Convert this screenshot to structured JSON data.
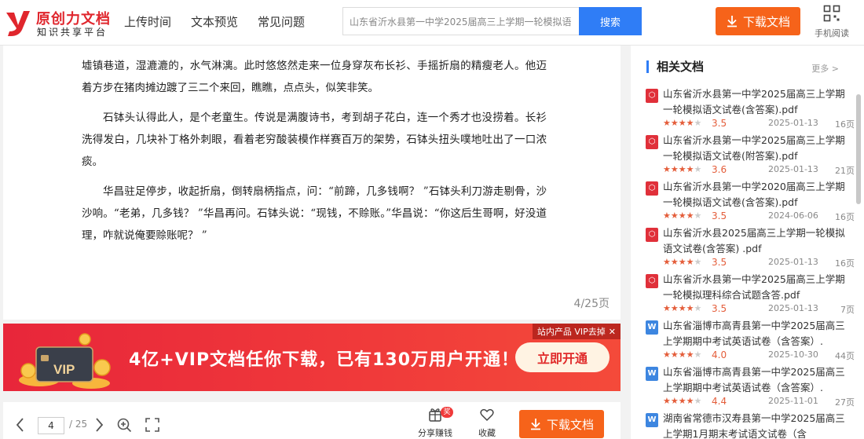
{
  "header": {
    "logo_name": "原创力文档",
    "logo_sub": "知识共享平台",
    "nav": [
      "上传时间",
      "文本预览",
      "常见问题"
    ],
    "search_value": "山东省沂水县第一中学2025届高三上学期一轮模拟语",
    "search_button": "搜索",
    "download_label": "下载文档",
    "mobile_label": "手机阅读"
  },
  "document": {
    "paragraphs": [
      "墟镇巷道，湿漉漉的，水气淋漓。此时悠悠然走来一位身穿灰布长衫、手摇折扇的精瘦老人。他迈着方步在猪肉摊边踱了三二个来回，瞧瞧，点点头，似笑非笑。",
      "石钵头认得此人，是个老童生。传说是满腹诗书，考到胡子花白，连一个秀才也没捞着。长衫洗得发白，几块补丁格外刺眼，看着老穷酸装模作样赛百万的架势，石钵头扭头噗地吐出了一口浓痰。",
      "华昌驻足停步，收起折扇，倒转扇柄指点，问：“前蹄，几多钱啊？ ”石钵头利刀游走剔骨，沙沙响。“老弟，几多钱？ ”华昌再问。石钵头说：“现钱，不赊账。”华昌说：“你这后生哥啊，好没道理，咋就说俺要赊账呢？ ”"
    ],
    "page_indicator": "4/25页"
  },
  "banner": {
    "vip_art_text": "VIP",
    "slogan": "4亿+VIP文档任你下载，已有130万用户开通！",
    "cta": "立即开通",
    "tag": "站内产品 VIP去掉"
  },
  "toolbar": {
    "current_page": "4",
    "total_pages": "/ 25",
    "share_label": "分享赚钱",
    "share_badge": "奖",
    "fav_label": "收藏",
    "download_label": "下载文档"
  },
  "sidebar": {
    "title": "相关文档",
    "more": "更多 >",
    "items": [
      {
        "type": "pdf",
        "name": "山东省沂水县第一中学2025届高三上学期一轮模拟语文试卷(含答案).pdf",
        "rating": 3.5,
        "score": "3.5",
        "date": "2025-01-13",
        "pages": "16页"
      },
      {
        "type": "pdf",
        "name": "山东省沂水县第一中学2025届高三上学期一轮模拟语文试卷(附答案).pdf",
        "rating": 3.6,
        "score": "3.6",
        "date": "2025-01-13",
        "pages": "21页"
      },
      {
        "type": "pdf",
        "name": "山东省沂水县第一中学2020届高三上学期一轮模拟语文试卷(含答案).pdf",
        "rating": 3.5,
        "score": "3.5",
        "date": "2024-06-06",
        "pages": "16页"
      },
      {
        "type": "pdf",
        "name": "山东省沂水县2025届高三上学期一轮模拟语文试卷(含答案) .pdf",
        "rating": 3.5,
        "score": "3.5",
        "date": "2025-01-13",
        "pages": "16页"
      },
      {
        "type": "pdf",
        "name": "山东省沂水县第一中学2025届高三上学期一轮模拟理科综合试题含答.pdf",
        "rating": 3.5,
        "score": "3.5",
        "date": "2025-01-13",
        "pages": "7页"
      },
      {
        "type": "word",
        "name": "山东省淄博市高青县第一中学2025届高三上学期期中考试英语试卷（含答案）.",
        "rating": 4.0,
        "score": "4.0",
        "date": "2025-10-30",
        "pages": "44页"
      },
      {
        "type": "word",
        "name": "山东省淄博市高青县第一中学2025届高三上学期期中考试英语试卷（含答案）.",
        "rating": 4.4,
        "score": "4.4",
        "date": "2025-11-01",
        "pages": "27页"
      },
      {
        "type": "word",
        "name": "湖南省常德市汉寿县第一中学2025届高三上学期1月期末考试语文试卷（含",
        "rating": 0,
        "score": "",
        "date": "",
        "pages": ""
      }
    ]
  },
  "colors": {
    "brand_red": "#e0262d",
    "accent_blue": "#2f7df6",
    "download_orange": "#f6631a",
    "banner_red": "#f03a3a"
  }
}
